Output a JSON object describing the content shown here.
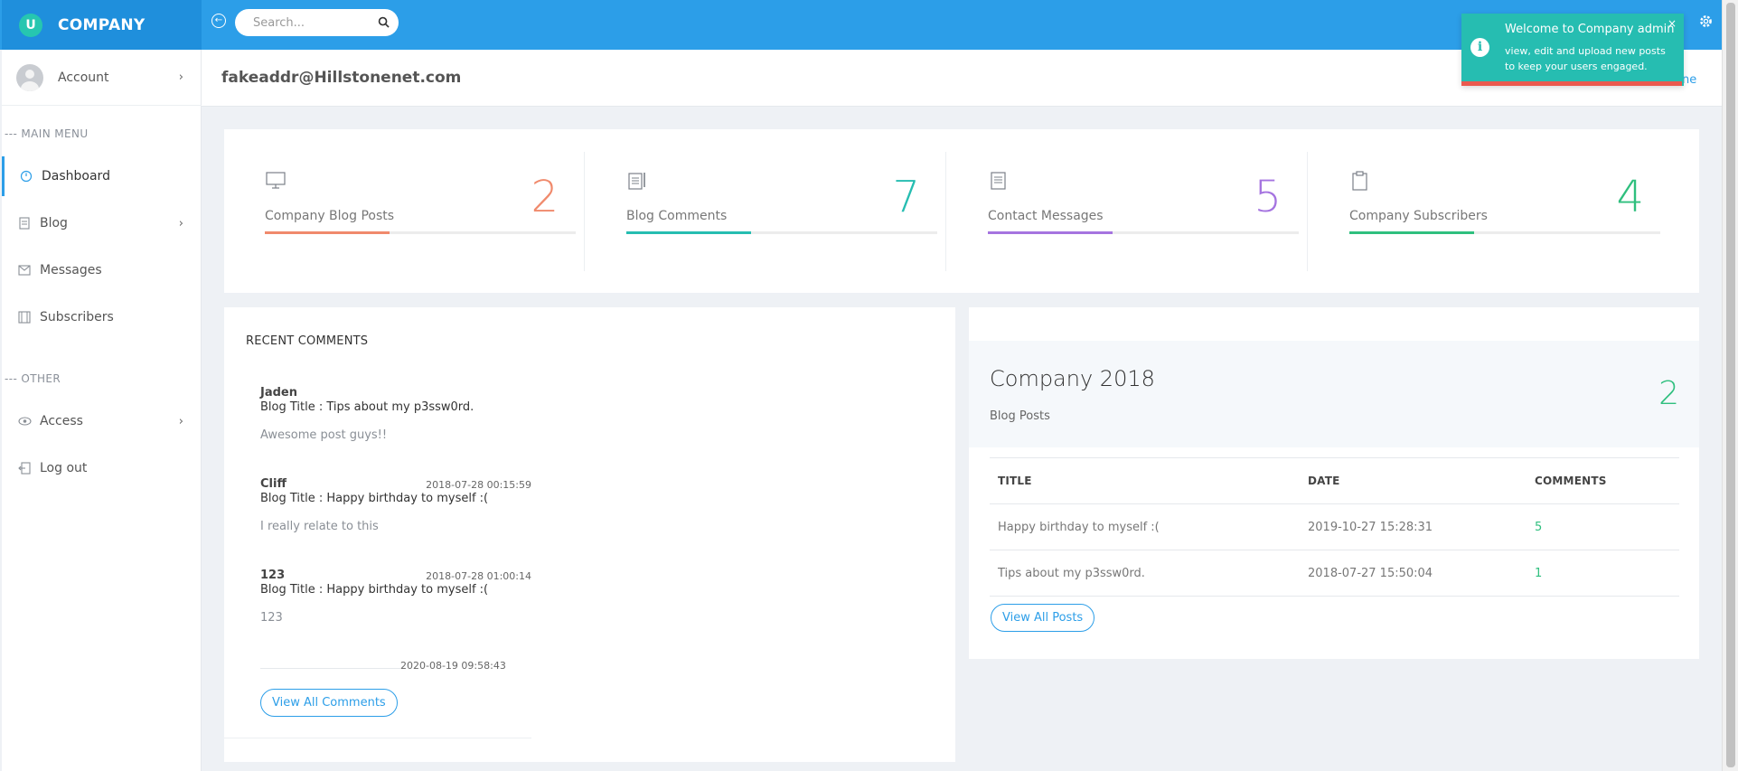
{
  "brand": {
    "logo_letter": "U",
    "name": "COMPANY"
  },
  "search": {
    "placeholder": "Search..."
  },
  "sidebar": {
    "account_label": "Account",
    "main_menu_label": "--- MAIN MENU",
    "items": [
      {
        "label": "Dashboard"
      },
      {
        "label": "Blog"
      },
      {
        "label": "Messages"
      },
      {
        "label": "Subscribers"
      }
    ],
    "other_label": "--- OTHER",
    "other_items": [
      {
        "label": "Access"
      },
      {
        "label": "Log out"
      }
    ]
  },
  "header": {
    "email": "fakeaddr@Hillstonenet.com",
    "link_fragment": "ne"
  },
  "stats": [
    {
      "label": "Company Blog Posts",
      "value": "2",
      "color": "#f08a6c",
      "progress": 0.4
    },
    {
      "label": "Blog Comments",
      "value": "7",
      "color": "#26bdb1",
      "progress": 0.4
    },
    {
      "label": "Contact Messages",
      "value": "5",
      "color": "#a574e0",
      "progress": 0.4
    },
    {
      "label": "Company Subscribers",
      "value": "4",
      "color": "#2fbf7e",
      "progress": 0.4
    }
  ],
  "comments": {
    "title": "RECENT COMMENTS",
    "items": [
      {
        "author": "Jaden",
        "date": "",
        "blog_title": "Blog Title : Tips about my p3ssw0rd.",
        "text": "Awesome post guys!!"
      },
      {
        "author": "Cliff",
        "date": "2018-07-28 00:15:59",
        "blog_title": "Blog Title : Happy birthday to myself :(",
        "text": "I really relate to this"
      },
      {
        "author": "123",
        "date": "2018-07-28 01:00:14",
        "blog_title": "Blog Title : Happy birthday to myself :(",
        "text": "123"
      }
    ],
    "last_date": "2020-08-19 09:58:43",
    "view_all_label": "View All Comments"
  },
  "posts": {
    "title": "Company 2018",
    "subtitle": "Blog Posts",
    "count": "2",
    "columns": [
      "TITLE",
      "DATE",
      "COMMENTS"
    ],
    "rows": [
      {
        "title": "Happy birthday to myself :(",
        "date": "2019-10-27 15:28:31",
        "comments": "5"
      },
      {
        "title": "Tips about my p3ssw0rd.",
        "date": "2018-07-27 15:50:04",
        "comments": "1"
      }
    ],
    "view_all_label": "View All Posts"
  },
  "toast": {
    "title": "Welcome to Company admin",
    "message": "view, edit and upload new posts to keep your users engaged.",
    "icon_glyph": "i",
    "close_glyph": "×"
  }
}
